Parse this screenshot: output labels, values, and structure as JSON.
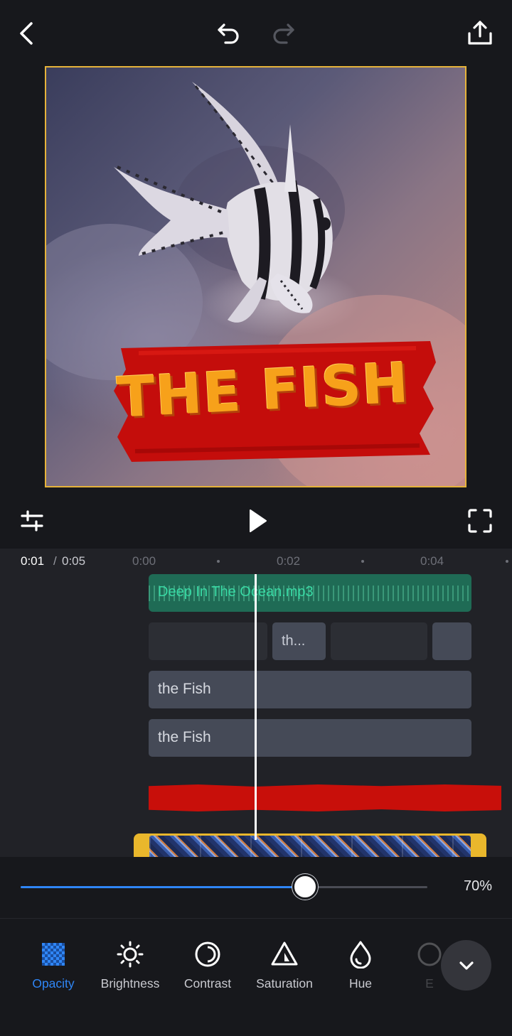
{
  "top_bar": {
    "back_icon": "chevron-left-icon",
    "undo_icon": "undo-icon",
    "redo_icon": "redo-icon",
    "share_icon": "share-upload-icon"
  },
  "preview": {
    "overlay_title": "THE FISH",
    "border_color": "#e6b33a"
  },
  "player": {
    "adjust_icon": "adjust-sliders-icon",
    "play_icon": "play-icon",
    "fullscreen_icon": "fullscreen-icon"
  },
  "timeline": {
    "current_time": "0:01",
    "separator": "/",
    "total_time": "0:05",
    "ticks": [
      "0:00",
      "0:02",
      "0:04"
    ],
    "audio_track": {
      "label": "Deep In The Ocean.mp3",
      "color": "#1f6b55"
    },
    "overlay_segment_label": "th...",
    "text_tracks": [
      "the Fish",
      "the Fish"
    ],
    "sticker_color": "#c80f0a",
    "video_border_color": "#e9b72c"
  },
  "slider": {
    "value": 70,
    "value_label": "70%",
    "fill_color": "#2f86f6"
  },
  "tools": {
    "items": [
      {
        "label": "Opacity",
        "icon": "opacity-checker-icon",
        "active": true
      },
      {
        "label": "Brightness",
        "icon": "brightness-sun-icon",
        "active": false
      },
      {
        "label": "Contrast",
        "icon": "contrast-circle-icon",
        "active": false
      },
      {
        "label": "Saturation",
        "icon": "saturation-triangle-icon",
        "active": false
      },
      {
        "label": "Hue",
        "icon": "hue-drop-icon",
        "active": false
      },
      {
        "label": "E",
        "icon": "exposure-icon",
        "active": false
      }
    ],
    "collapse_icon": "chevron-down-icon",
    "accent_color": "#2f86f6"
  }
}
